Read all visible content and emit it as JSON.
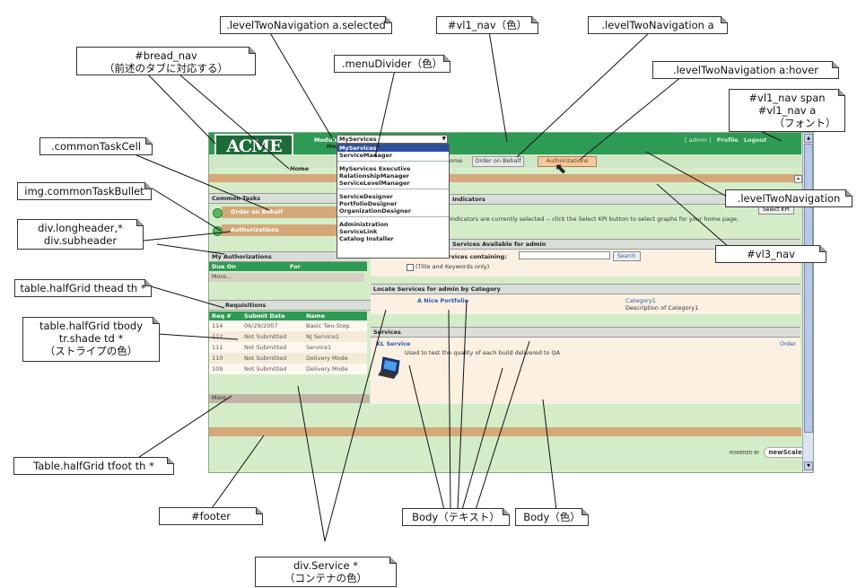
{
  "callouts": {
    "bread_nav": "#bread_nav",
    "bread_nav_sub": "（前述のタブに対応する）",
    "level_two_selected": ".levelTwoNavigation a.selected",
    "vl1_nav_color": "#vl1_nav（色）",
    "level_two_a": ".levelTwoNavigation a",
    "menu_divider": ".menuDivider（色）",
    "level_two_hover": ".levelTwoNavigation a:hover",
    "vl1_nav_span": "#vl1_nav span",
    "vl1_nav_a": "#vl1_nav a",
    "font": "（フォント）",
    "common_task_cell": ".commonTaskCell",
    "common_task_bullet": "img.commonTaskBullet",
    "longheader": "div.longheader,*",
    "subheader": "div.subheader",
    "level_two_nav": ".levelTwoNavigation",
    "vl3_nav": "#vl3_nav",
    "thead_th": "table.halfGrid thead th *",
    "tbody_td_1": "table.halfGrid tbody",
    "tbody_td_2": "tr.shade  td *",
    "tbody_td_3": "（ストライプの色）",
    "tfoot_th": "Table.halfGrid tfoot th *",
    "footer": "#footer",
    "div_service": "div.Service *",
    "div_service_sub": "（コンテナの色）",
    "body_text": "Body（テキスト）",
    "body_color": "Body（色）"
  },
  "app": {
    "logo": "ACME",
    "module_label": "Module",
    "module_select": "MyServices",
    "header_links": [
      "[ admin ]",
      "Profile",
      "Logout"
    ],
    "dropdown_items": [
      {
        "label": "MyServices",
        "selected": true
      },
      {
        "label": "ServiceManager"
      },
      {
        "divider": true
      },
      {
        "label": "MyServices Executive"
      },
      {
        "label": "RelationshipManager"
      },
      {
        "label": "ServiceLevelManager"
      },
      {
        "divider": true
      },
      {
        "label": "ServiceDesigner"
      },
      {
        "label": "PortfolioDesigner"
      },
      {
        "label": "OrganizationDesigner"
      },
      {
        "divider": true
      },
      {
        "label": "Administration"
      },
      {
        "label": "ServiceLink"
      },
      {
        "label": "Catalog Installer"
      }
    ],
    "home_tab": "Home",
    "home_tab_partial": "Home",
    "tab_partial": "ome",
    "tab_order_on_behalf": "Order on Behalf",
    "tab_authorizations": "Authorizations",
    "common_tasks_title": "Common Tasks",
    "task_order_on_behalf": "Order on Behalf",
    "task_authorizations": "Authorizations",
    "my_authorizations_title": "My Authorizations",
    "auth_due_on": "Due On",
    "auth_for": "For",
    "auth_more": "More...",
    "requisitions_title": "Requisitions",
    "req_headers": [
      "Req #",
      "Submit Date",
      "Name"
    ],
    "req_rows": [
      [
        "114",
        "06/29/2007",
        "Basic Two-Step"
      ],
      [
        "112",
        "Not Submitted",
        "NJ Service1"
      ],
      [
        "111",
        "Not Submitted",
        "Service1"
      ],
      [
        "110",
        "Not Submitted",
        "Delivery Mode"
      ],
      [
        "109",
        "Not Submitted",
        "Delivery Mode"
      ]
    ],
    "req_more": "More...",
    "indicators_title": "Indicators",
    "select_kpi": "Select KPI",
    "indicators_text": "Indicators are currently selected -- click the Select KPI button to select graphs for your home page.",
    "services_available_title": "Services Available for admin",
    "search_label": "Search for services containing:",
    "search_button": "Search",
    "title_keywords": "(Title and Keywords only)",
    "locate_title": "Locate Services for admin by Category",
    "portfolio_link": "A Nice Portfolio",
    "category_link": "Category1",
    "category_desc": "Description of Category1",
    "services_title": "Services",
    "service_link": "KL Service",
    "order_link": "Order",
    "service_desc": "Used to test the quality of each build delivered to QA",
    "powered_by": "POWERED BY",
    "newscale": "newScale"
  }
}
